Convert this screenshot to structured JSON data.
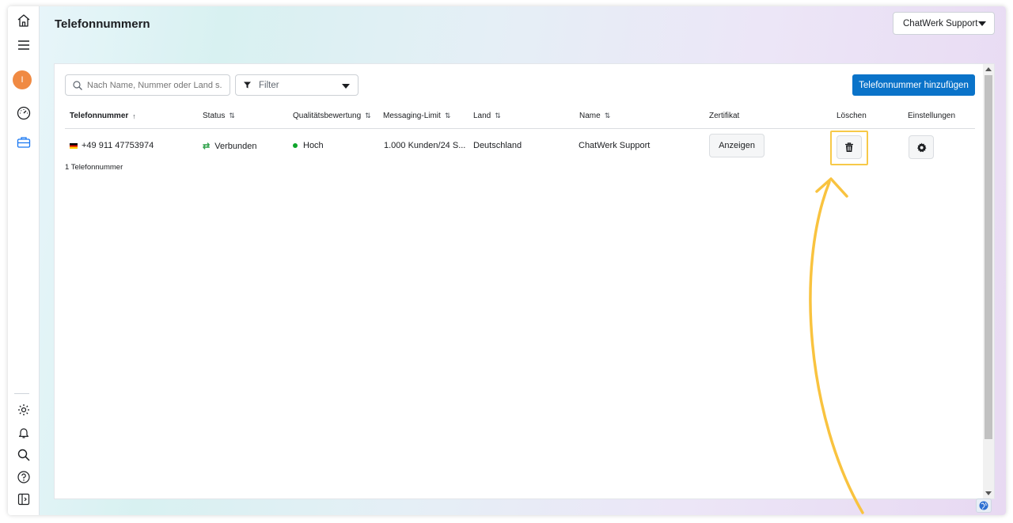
{
  "page": {
    "title": "Telefonnummern"
  },
  "account": {
    "selected": "ChatWerk Support"
  },
  "sidebar": {
    "avatar_initial": "I",
    "icons": [
      "home-icon",
      "menu-icon",
      "dashboard-icon",
      "briefcase-icon",
      "settings-icon",
      "bell-icon",
      "search-icon",
      "help-icon",
      "panel-toggle-icon"
    ]
  },
  "toolbar": {
    "search_placeholder": "Nach Name, Nummer oder Land s...",
    "filter_label": "Filter",
    "add_button": "Telefonnummer hinzufügen"
  },
  "table": {
    "columns": [
      {
        "label": "Telefonnummer",
        "sort": "↑"
      },
      {
        "label": "Status",
        "sort": "⇅"
      },
      {
        "label": "Qualitätsbewertung",
        "sort": "⇅"
      },
      {
        "label": "Messaging-Limit",
        "sort": "⇅"
      },
      {
        "label": "Land",
        "sort": "⇅"
      },
      {
        "label": "Name",
        "sort": "⇅"
      },
      {
        "label": "Zertifikat",
        "sort": ""
      },
      {
        "label": "Löschen",
        "sort": ""
      },
      {
        "label": "Einstellungen",
        "sort": ""
      }
    ],
    "rows": [
      {
        "phone": "+49 911 47753974",
        "status": "Verbunden",
        "quality": "Hoch",
        "limit": "1.000 Kunden/24 S...",
        "country": "Deutschland",
        "name": "ChatWerk Support",
        "certificate_button": "Anzeigen"
      }
    ],
    "count_label": "1 Telefonnummer"
  },
  "colors": {
    "primary": "#0a73c9",
    "highlight": "#f7c948",
    "status_green": "#31a24c",
    "quality_green": "#0ea52b",
    "avatar": "#f08a43"
  }
}
